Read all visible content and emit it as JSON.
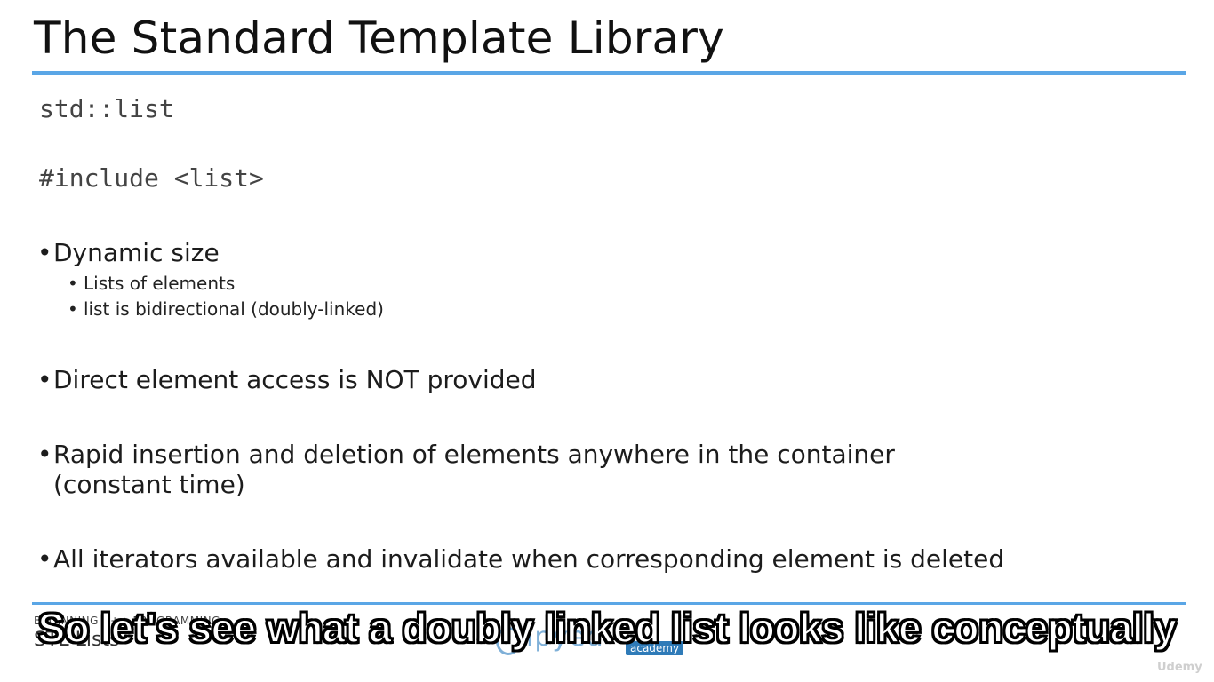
{
  "slide": {
    "title": "The Standard Template Library",
    "code_lines": [
      "std::list",
      "#include <list>"
    ],
    "bullets": [
      {
        "text": "Dynamic size",
        "sub": [
          "Lists of elements",
          "list is bidirectional (doubly-linked)"
        ]
      },
      {
        "text": "Direct element access is NOT provided"
      },
      {
        "text": "Rapid insertion and deletion of elements anywhere in the container",
        "continuation": "(constant time)"
      },
      {
        "text": "All iterators available and invalidate when corresponding element is deleted"
      }
    ],
    "bullet_glyph": "•"
  },
  "footer": {
    "course": "BEGINNING C++ PROGRAMMING",
    "section": "STL Lists",
    "logo_word": "lpyed",
    "logo_tag": "academy"
  },
  "caption": "So let's see what a doubly linked list looks like conceptually",
  "watermark": "Udemy",
  "colors": {
    "accent_rule": "#5aa6e6",
    "logo_blue": "#2f7bb8"
  }
}
